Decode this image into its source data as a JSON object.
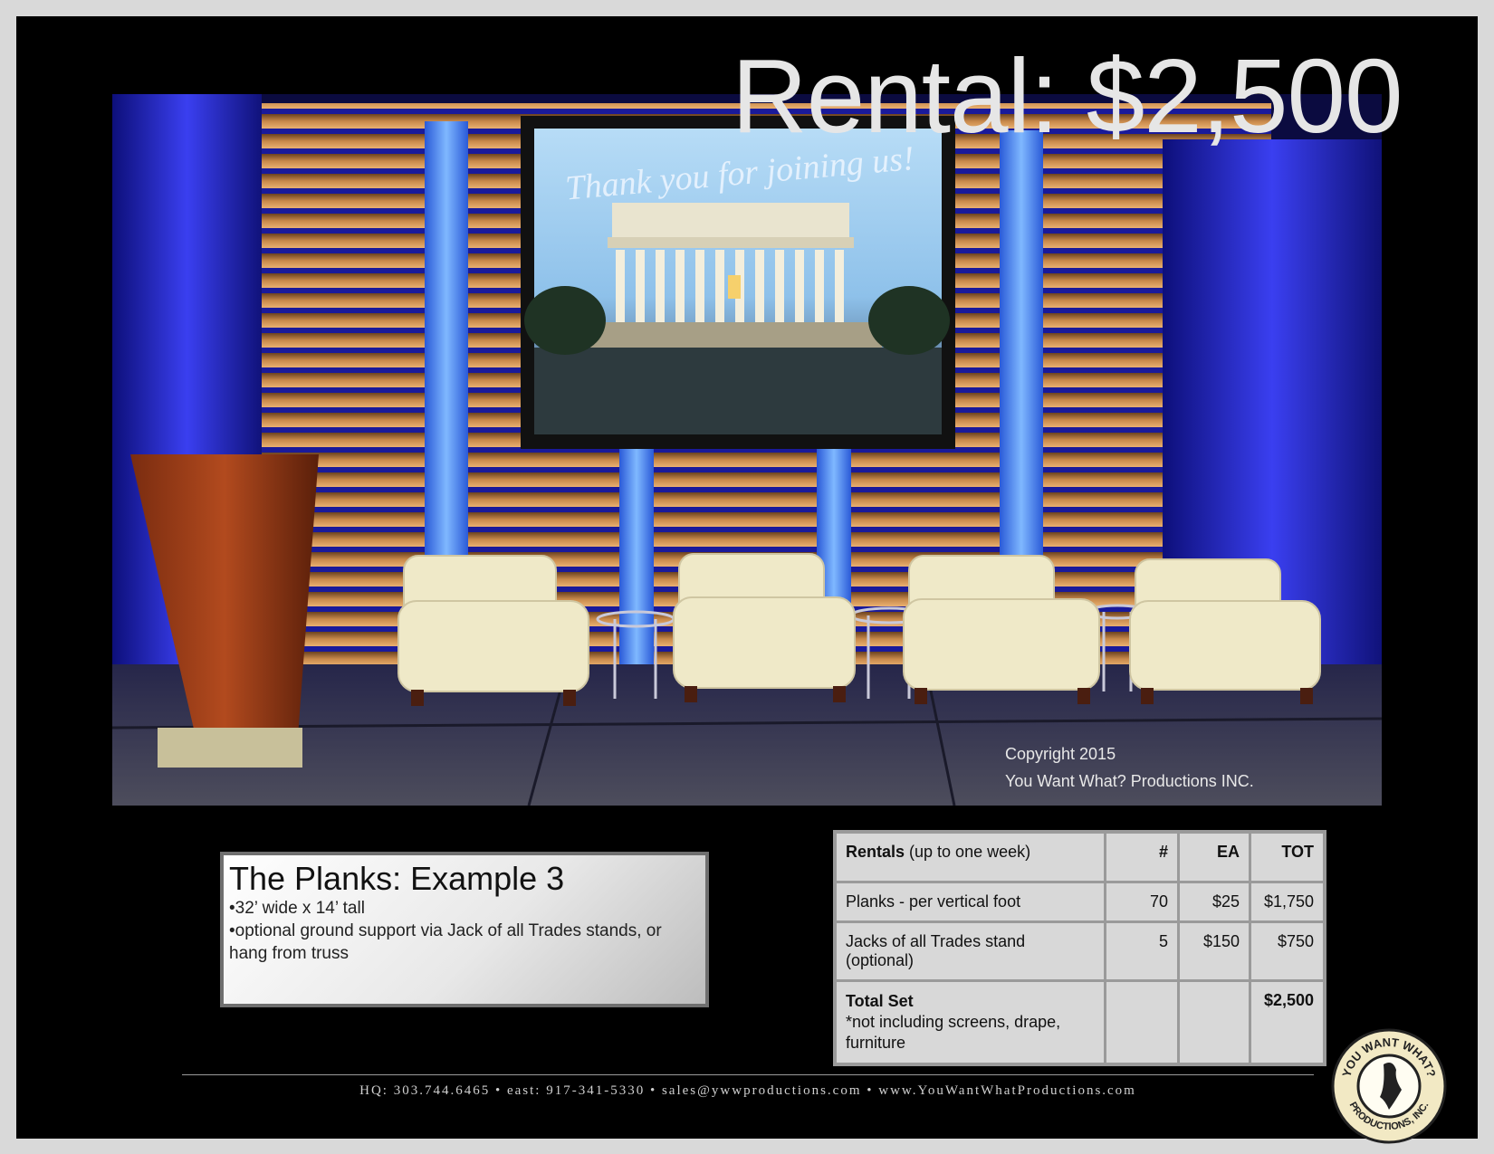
{
  "headline": "Rental: $2,500",
  "photo": {
    "screen_text": "Thank you for joining us!",
    "copyright_line1": "Copyright 2015",
    "copyright_line2": "You Want What? Productions INC."
  },
  "description": {
    "title": "The Planks: Example 3",
    "bullet1": "•32’ wide x 14’ tall",
    "bullet2": "•optional ground support via Jack of all Trades stands, or hang from truss"
  },
  "table": {
    "header": {
      "label_bold": "Rentals",
      "label_rest": " (up to one week)",
      "qty": "#",
      "ea": "EA",
      "tot": "TOT"
    },
    "rows": [
      {
        "item": "Planks - per vertical foot",
        "qty": "70",
        "ea": "$25",
        "tot": "$1,750"
      },
      {
        "item": "Jacks of all Trades stand (optional)",
        "qty": "5",
        "ea": "$150",
        "tot": "$750"
      }
    ],
    "total": {
      "label": "Total Set",
      "note": "*not including screens, drape, furniture",
      "tot": "$2,500"
    }
  },
  "footer": {
    "contact": "HQ: 303.744.6465 • east: 917-341-5330 • sales@ywwproductions.com • www.YouWantWhatProductions.com"
  },
  "logo": {
    "text_top": "YOU WANT WHAT?",
    "text_bottom": "PRODUCTIONS, INC."
  },
  "colors": {
    "page_bg": "#000000",
    "drape_blue": "#2a2ad8",
    "plank_wood": "#b5773a",
    "table_bg": "#d8d8d8"
  }
}
